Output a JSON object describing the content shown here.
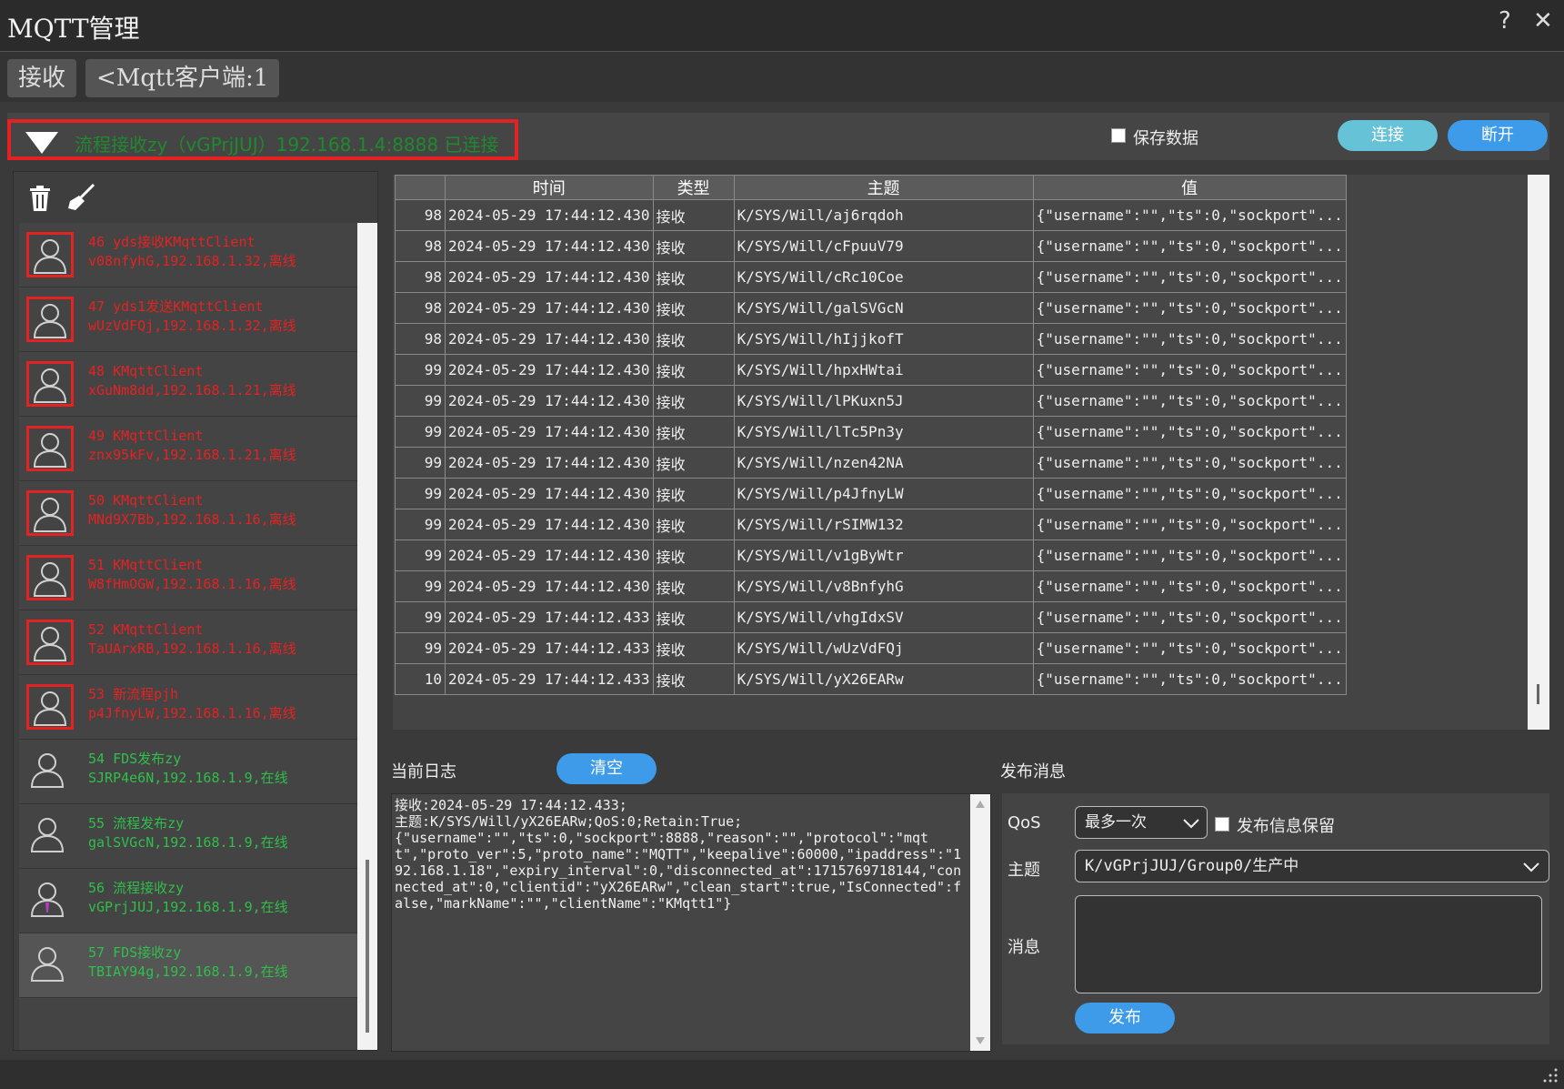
{
  "window": {
    "title": "MQTT管理",
    "help": "?",
    "close": "✕"
  },
  "tabs": [
    {
      "label": "接收"
    },
    {
      "label": "<Mqtt客户端:1"
    }
  ],
  "connection": {
    "status_text": "流程接收zy（vGPrjJUJ）192.168.1.4:8888 已连接",
    "save_data_label": "保存数据",
    "save_data_checked": false,
    "connect_label": "连接",
    "disconnect_label": "断开",
    "colors": {
      "connect": "#66c2d6",
      "disconnect": "#3d9be9",
      "highlight": "#e52222"
    }
  },
  "toolbar": {
    "delete_icon": "trash-icon",
    "clear_icon": "broom-icon"
  },
  "clients": [
    {
      "line1": "46 yds接收KMqttClient",
      "line2": "v08nfyhG,192.168.1.32,离线",
      "online": false
    },
    {
      "line1": "47 yds1发送KMqttClient",
      "line2": "wUzVdFQj,192.168.1.32,离线",
      "online": false
    },
    {
      "line1": "48 KMqttClient",
      "line2": "xGuNm8dd,192.168.1.21,离线",
      "online": false
    },
    {
      "line1": "49 KMqttClient",
      "line2": "znx95kFv,192.168.1.21,离线",
      "online": false
    },
    {
      "line1": "50 KMqttClient",
      "line2": "MNd9X7Bb,192.168.1.16,离线",
      "online": false
    },
    {
      "line1": "51 KMqttClient",
      "line2": "W8fHmOGW,192.168.1.16,离线",
      "online": false
    },
    {
      "line1": "52 KMqttClient",
      "line2": "TaUArxRB,192.168.1.16,离线",
      "online": false
    },
    {
      "line1": "53 新流程pjh",
      "line2": "p4JfnyLW,192.168.1.16,离线",
      "online": false
    },
    {
      "line1": "54 FDS发布zy",
      "line2": "SJRP4e6N,192.168.1.9,在线",
      "online": true
    },
    {
      "line1": "55 流程发布zy",
      "line2": "galSVGcN,192.168.1.9,在线",
      "online": true
    },
    {
      "line1": "56 流程接收zy",
      "line2": "vGPrjJUJ,192.168.1.9,在线",
      "online": true
    },
    {
      "line1": "57 FDS接收zy",
      "line2": "TBIAY94g,192.168.1.9,在线",
      "online": true,
      "selected": true
    }
  ],
  "table": {
    "headers": [
      "",
      "时间",
      "类型",
      "主题",
      "值"
    ],
    "rows": [
      [
        "98",
        "2024-05-29 17:44:12.430",
        "接收",
        "K/SYS/Will/aj6rqdoh",
        "{\"username\":\"\",\"ts\":0,\"sockport\"..."
      ],
      [
        "98",
        "2024-05-29 17:44:12.430",
        "接收",
        "K/SYS/Will/cFpuuV79",
        "{\"username\":\"\",\"ts\":0,\"sockport\"..."
      ],
      [
        "98",
        "2024-05-29 17:44:12.430",
        "接收",
        "K/SYS/Will/cRc10Coe",
        "{\"username\":\"\",\"ts\":0,\"sockport\"..."
      ],
      [
        "98",
        "2024-05-29 17:44:12.430",
        "接收",
        "K/SYS/Will/galSVGcN",
        "{\"username\":\"\",\"ts\":0,\"sockport\"..."
      ],
      [
        "98",
        "2024-05-29 17:44:12.430",
        "接收",
        "K/SYS/Will/hIjjkofT",
        "{\"username\":\"\",\"ts\":0,\"sockport\"..."
      ],
      [
        "99",
        "2024-05-29 17:44:12.430",
        "接收",
        "K/SYS/Will/hpxHWtai",
        "{\"username\":\"\",\"ts\":0,\"sockport\"..."
      ],
      [
        "99",
        "2024-05-29 17:44:12.430",
        "接收",
        "K/SYS/Will/lPKuxn5J",
        "{\"username\":\"\",\"ts\":0,\"sockport\"..."
      ],
      [
        "99",
        "2024-05-29 17:44:12.430",
        "接收",
        "K/SYS/Will/lTc5Pn3y",
        "{\"username\":\"\",\"ts\":0,\"sockport\"..."
      ],
      [
        "99",
        "2024-05-29 17:44:12.430",
        "接收",
        "K/SYS/Will/nzen42NA",
        "{\"username\":\"\",\"ts\":0,\"sockport\"..."
      ],
      [
        "99",
        "2024-05-29 17:44:12.430",
        "接收",
        "K/SYS/Will/p4JfnyLW",
        "{\"username\":\"\",\"ts\":0,\"sockport\"..."
      ],
      [
        "99",
        "2024-05-29 17:44:12.430",
        "接收",
        "K/SYS/Will/rSIMW132",
        "{\"username\":\"\",\"ts\":0,\"sockport\"..."
      ],
      [
        "99",
        "2024-05-29 17:44:12.430",
        "接收",
        "K/SYS/Will/v1gByWtr",
        "{\"username\":\"\",\"ts\":0,\"sockport\"..."
      ],
      [
        "99",
        "2024-05-29 17:44:12.430",
        "接收",
        "K/SYS/Will/v8BnfyhG",
        "{\"username\":\"\",\"ts\":0,\"sockport\"..."
      ],
      [
        "99",
        "2024-05-29 17:44:12.433",
        "接收",
        "K/SYS/Will/vhgIdxSV",
        "{\"username\":\"\",\"ts\":0,\"sockport\"..."
      ],
      [
        "99",
        "2024-05-29 17:44:12.433",
        "接收",
        "K/SYS/Will/wUzVdFQj",
        "{\"username\":\"\",\"ts\":0,\"sockport\"..."
      ],
      [
        "10",
        "2024-05-29 17:44:12.433",
        "接收",
        "K/SYS/Will/yX26EARw",
        "{\"username\":\"\",\"ts\":0,\"sockport\"..."
      ]
    ]
  },
  "log": {
    "label": "当前日志",
    "clear_label": "清空",
    "text": "接收:2024-05-29 17:44:12.433;\n主题:K/SYS/Will/yX26EARw;QoS:0;Retain:True;\n{\"username\":\"\",\"ts\":0,\"sockport\":8888,\"reason\":\"\",\"protocol\":\"mqtt\",\"proto_ver\":5,\"proto_name\":\"MQTT\",\"keepalive\":60000,\"ipaddress\":\"192.168.1.18\",\"expiry_interval\":0,\"disconnected_at\":1715769718144,\"connected_at\":0,\"clientid\":\"yX26EARw\",\"clean_start\":true,\"IsConnected\":false,\"markName\":\"\",\"clientName\":\"KMqtt1\"}"
  },
  "publish": {
    "label": "发布消息",
    "qos_label": "QoS",
    "qos_value": "最多一次",
    "retain_label": "发布信息保留",
    "topic_label": "主题",
    "topic_value": "K/vGPrjJUJ/Group0/生产中",
    "message_label": "消息",
    "message_value": "",
    "publish_label": "发布"
  }
}
